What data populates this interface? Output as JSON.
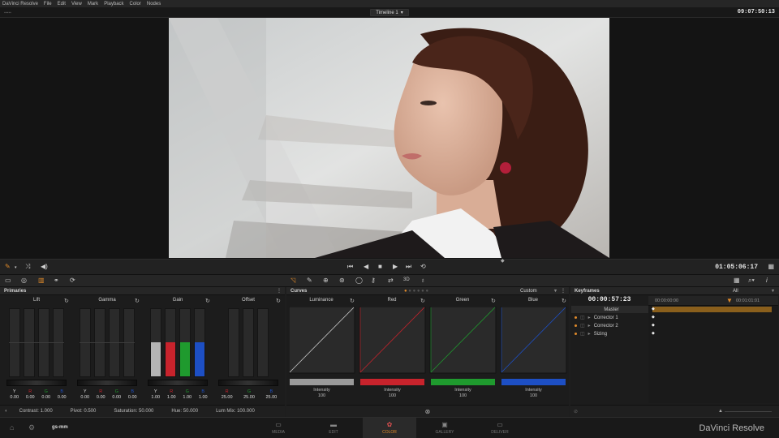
{
  "menu": {
    "items": [
      "DaVinci Resolve",
      "File",
      "Edit",
      "View",
      "Mark",
      "Playback",
      "Color",
      "Nodes"
    ]
  },
  "viewer": {
    "timeline_label": "Timeline 1",
    "timecode": "09:07:50:13"
  },
  "transport": {
    "timecode": "01:05:06:17"
  },
  "primaries": {
    "title": "Primaries",
    "wheels": [
      {
        "name": "Lift",
        "labels": [
          "Y",
          "R",
          "G",
          "B"
        ],
        "values": [
          "0.00",
          "0.00",
          "0.00",
          "0.00"
        ]
      },
      {
        "name": "Gamma",
        "labels": [
          "Y",
          "R",
          "G",
          "B"
        ],
        "values": [
          "0.00",
          "0.00",
          "0.00",
          "0.00"
        ]
      },
      {
        "name": "Gain",
        "labels": [
          "Y",
          "R",
          "G",
          "B"
        ],
        "values": [
          "1.00",
          "1.00",
          "1.00",
          "1.00"
        ]
      },
      {
        "name": "Offset",
        "labels": [
          "R",
          "G",
          "B"
        ],
        "values": [
          "25.00",
          "25.00",
          "25.00"
        ]
      }
    ],
    "footer": {
      "contrast": "Contrast: 1.000",
      "pivot": "Pivot: 0.500",
      "saturation": "Saturation: 50.000",
      "hue": "Hue: 50.000",
      "lum_mix": "Lum Mix: 100.000"
    }
  },
  "curves": {
    "title": "Curves",
    "mode": "Custom",
    "channels": [
      {
        "name": "Luminance",
        "label": "Intensity",
        "value": "100",
        "color": "#9a9a9a"
      },
      {
        "name": "Red",
        "label": "Intensity",
        "value": "100",
        "color": "#c8232c"
      },
      {
        "name": "Green",
        "label": "Intensity",
        "value": "100",
        "color": "#1f9a2e"
      },
      {
        "name": "Blue",
        "label": "Intensity",
        "value": "100",
        "color": "#1d4fc4"
      }
    ]
  },
  "keyframes": {
    "title": "Keyframes",
    "filter": "All",
    "timecode": "00:00:57:23",
    "ruler_start": "00:00:00:00",
    "ruler_mark": "00:01:01:01",
    "rows": [
      "Master",
      "Corrector 1",
      "Corrector 2",
      "Sizing"
    ]
  },
  "status": {
    "project": "gs-mm"
  },
  "nav": {
    "items": [
      "MEDIA",
      "EDIT",
      "COLOR",
      "GALLERY",
      "DELIVER"
    ],
    "active": "COLOR"
  },
  "brand": "DaVinci Resolve",
  "colors": {
    "accent": "#e08a2a",
    "gain_r": "#c8232c",
    "gain_g": "#1f9a2e",
    "gain_b": "#1d4fc4"
  }
}
